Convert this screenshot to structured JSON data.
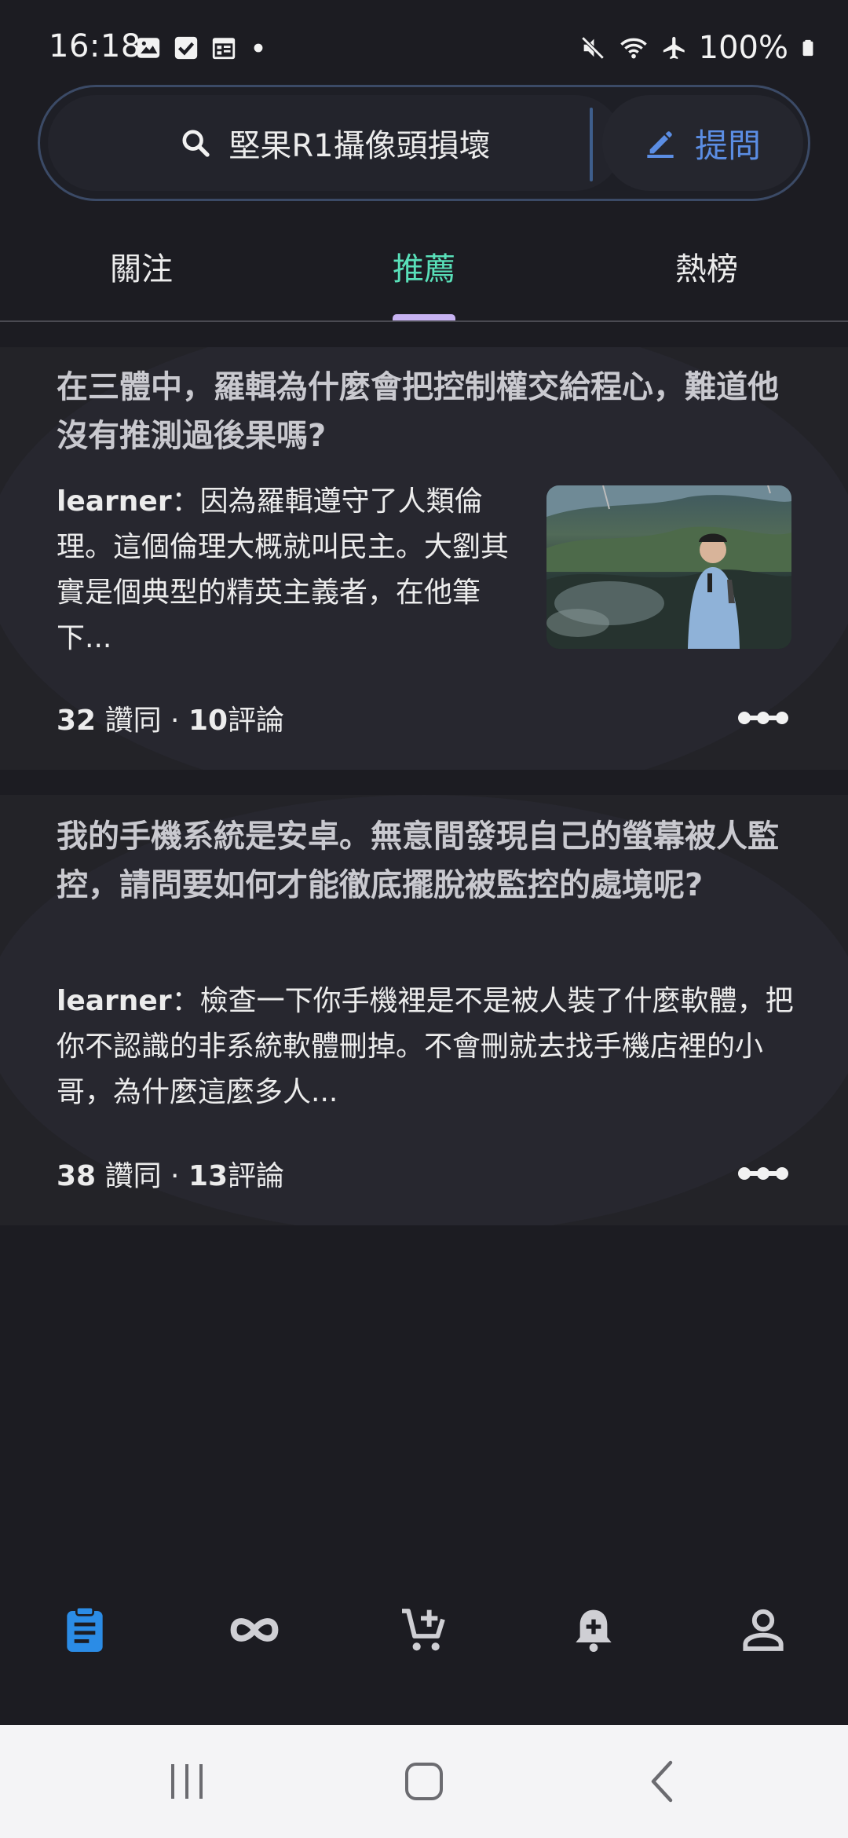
{
  "status_bar": {
    "time": "16:18",
    "battery": "100%",
    "icons_left": [
      "image-icon",
      "check-box-icon",
      "calendar-icon",
      "dot-icon"
    ],
    "icons_right": [
      "mute-icon",
      "wifi-icon",
      "airplane-icon",
      "battery-icon"
    ]
  },
  "search": {
    "text": "堅果R1攝像頭損壞",
    "ask_label": "提問"
  },
  "tabs": [
    {
      "label": "關注",
      "active": false
    },
    {
      "label": "推薦",
      "active": true
    },
    {
      "label": "熱榜",
      "active": false
    }
  ],
  "feed": [
    {
      "title": "在三體中，羅輯為什麼會把控制權交給程心，難道他沒有推測過後果嗎?",
      "author": "learner",
      "separator": "：",
      "excerpt": "因為羅輯遵守了人類倫理。這個倫理大概就叫民主。大劉其實是個典型的精英主義者，在他筆下...",
      "has_thumbnail": true,
      "likes": "32",
      "likes_label": "讚同",
      "dot": "·",
      "comments": "10",
      "comments_label": "評論"
    },
    {
      "title": "我的手機系統是安卓。無意間發現自己的螢幕被人監控，請問要如何才能徹底擺脫被監控的處境呢?",
      "author": "learner",
      "separator": "：",
      "excerpt": "檢查一下你手機裡是不是被人裝了什麼軟體，把你不認識的非系統軟體刪掉。不會刪就去找手機店裡的小哥，為什麼這麼多人...",
      "has_thumbnail": false,
      "likes": "38",
      "likes_label": "讚同",
      "dot": "·",
      "comments": "13",
      "comments_label": "評論"
    }
  ],
  "bottom_nav": [
    {
      "icon": "clipboard-icon",
      "active": true
    },
    {
      "icon": "infinity-icon",
      "active": false
    },
    {
      "icon": "cart-add-icon",
      "active": false
    },
    {
      "icon": "bell-add-icon",
      "active": false
    },
    {
      "icon": "person-icon",
      "active": false
    }
  ],
  "colors": {
    "background": "#1c1c22",
    "active_tab": "#59e0b9",
    "tab_indicator": "#c7b2f2",
    "ask_accent": "#5b8de3",
    "nav_active": "#2b8ce6"
  }
}
